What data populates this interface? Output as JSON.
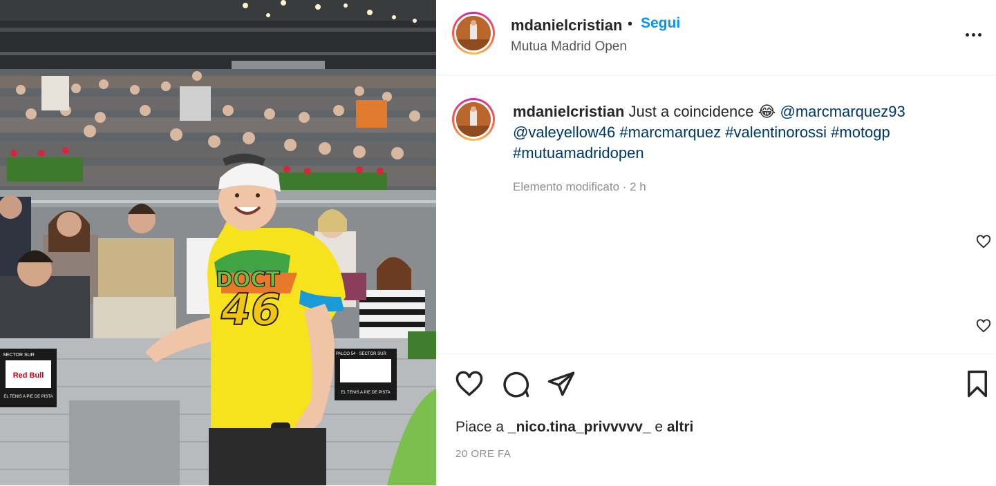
{
  "post": {
    "username": "mdanielcristian",
    "separator": "•",
    "follow_label": "Segui",
    "location": "Mutua Madrid Open"
  },
  "caption": {
    "username": "mdanielcristian",
    "text": "Just a coincidence",
    "emoji": "😂",
    "mention1": "@marcmarquez93",
    "mention2": "@valeyellow46",
    "tags": [
      "#marcmarquez",
      "#valentinorossi",
      "#motogp",
      "#mutuamadridopen"
    ],
    "meta": "Elemento modificato · 2 h"
  },
  "likes": {
    "prefix": "Piace a",
    "user": "_nico.tina_privvvvv_",
    "middle": "e",
    "suffix": "altri"
  },
  "time_ago": "20 ORE FA",
  "photo": {
    "shirt_text": "DOCT",
    "shirt_number": "46",
    "sign1_title": "Red Bull",
    "sign1_line": "EL TENIS A PIE DE PISTA",
    "sign1_sector": "SECTOR SUR",
    "sign2_sector": "PALCO 54 · SECTOR SUR",
    "sign2_line": "EL TENIS A PIE DE PISTA"
  },
  "colors": {
    "accent": "#0095f6",
    "link": "#00376b",
    "shirt": "#f6e31c"
  }
}
